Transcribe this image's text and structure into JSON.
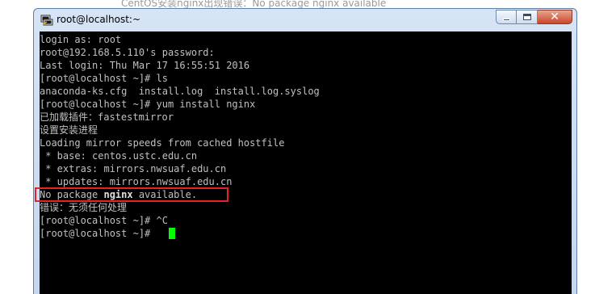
{
  "background": {
    "partial_text": "CentOS安装nginx出现错误：No package nginx available"
  },
  "window": {
    "title": "root@localhost:~",
    "icon": "putty-terminal-icon",
    "controls": [
      "minimize",
      "maximize",
      "close"
    ]
  },
  "terminal": {
    "lines": [
      "login as: root",
      "root@192.168.5.110's password:",
      "Last login: Thu Mar 17 16:55:51 2016",
      "[root@localhost ~]# ls",
      "anaconda-ks.cfg  install.log  install.log.syslog",
      "[root@localhost ~]# yum install nginx",
      "已加载插件：fastestmirror",
      "设置安装进程",
      "Loading mirror speeds from cached hostfile",
      " * base: centos.ustc.edu.cn",
      " * extras: mirrors.nwsuaf.edu.cn",
      " * updates: mirrors.nwsuaf.edu.cn",
      "",
      "错误：无须任何处理",
      "[root@localhost ~]# ^C",
      "[root@localhost ~]# "
    ],
    "error_line": {
      "prefix": "No package ",
      "package": "nginx",
      "suffix": " available."
    }
  },
  "colors": {
    "terminal_bg": "#000000",
    "terminal_fg": "#c0c0c0",
    "cursor": "#00ff00",
    "highlight": "#e2232a"
  }
}
